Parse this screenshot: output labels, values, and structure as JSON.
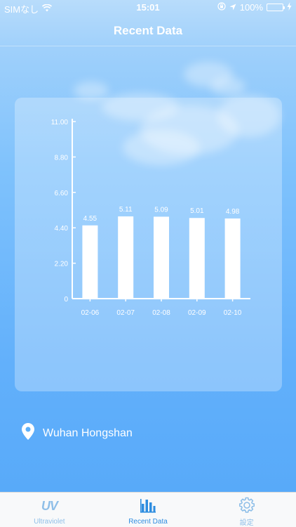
{
  "status_bar": {
    "carrier": "SIMなし",
    "time": "15:01",
    "battery": "100%",
    "battery_color": "#4cd964"
  },
  "nav": {
    "title": "Recent Data"
  },
  "chart_data": {
    "type": "bar",
    "categories": [
      "02-06",
      "02-07",
      "02-08",
      "02-09",
      "02-10"
    ],
    "values": [
      4.55,
      5.11,
      5.09,
      5.01,
      4.98
    ],
    "value_labels": [
      "4.55",
      "5.11",
      "5.09",
      "5.01",
      "4.98"
    ],
    "y_ticks": [
      "0",
      "2.20",
      "4.40",
      "6.60",
      "8.80",
      "11.00"
    ],
    "ylim": [
      0,
      11
    ],
    "xlabel": "",
    "ylabel": "",
    "bar_color": "#ffffff",
    "grid": false
  },
  "location": {
    "icon": "location-pin-icon",
    "label": "Wuhan Hongshan"
  },
  "tab_bar": {
    "active_color": "#2e8de0",
    "inactive_color": "#8fbfe8",
    "items": [
      {
        "label": "Ultraviolet",
        "icon": "uv-icon",
        "glyph": "UV",
        "active": false
      },
      {
        "label": "Recent Data",
        "icon": "bar-chart-icon",
        "active": true
      },
      {
        "label": "設定",
        "icon": "gear-icon",
        "active": false
      }
    ]
  }
}
